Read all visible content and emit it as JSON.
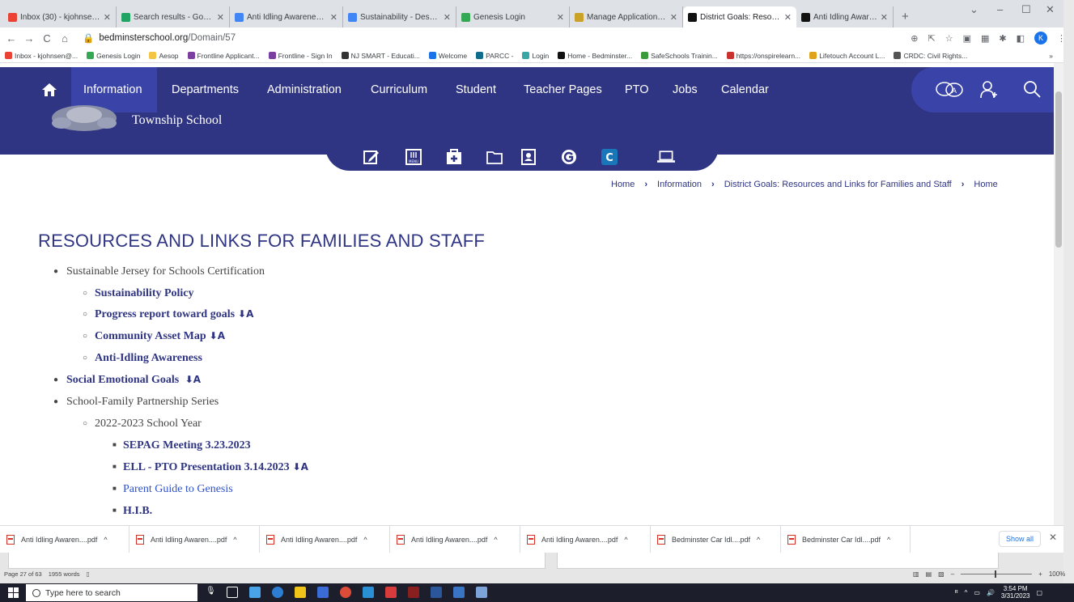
{
  "browser": {
    "tabs": [
      {
        "label": "Inbox (30) - kjohnsen@be",
        "icon": "gmail-icon",
        "color": "#ea4335"
      },
      {
        "label": "Search results - Google D",
        "icon": "google-drive-icon",
        "color": "#1fa463"
      },
      {
        "label": "Anti Idling Awareness - Go",
        "icon": "google-docs-icon",
        "color": "#4285f4"
      },
      {
        "label": "Sustainability - Descriptio",
        "icon": "google-docs-icon",
        "color": "#4285f4"
      },
      {
        "label": "Genesis Login",
        "icon": "genesis-icon",
        "color": "#34a853"
      },
      {
        "label": "Manage Application - Sust",
        "icon": "app-icon",
        "color": "#c9a227"
      },
      {
        "label": "District Goals: Resources a",
        "icon": "bb-icon",
        "color": "#111111",
        "active": true
      },
      {
        "label": "Anti Idling Awareness",
        "icon": "bb-icon",
        "color": "#111111"
      }
    ],
    "new_tab": "+",
    "url_host": "bedminsterschool.org",
    "url_path": "/Domain/57",
    "profile_initial": "K",
    "bookmarks": [
      {
        "label": "Inbox - kjohnsen@...",
        "color": "#ea4335"
      },
      {
        "label": "Genesis Login",
        "color": "#34a853"
      },
      {
        "label": "Aesop",
        "color": "#f4c542"
      },
      {
        "label": "Frontline Applicant...",
        "color": "#7b3fa0"
      },
      {
        "label": "Frontline - Sign In",
        "color": "#7b3fa0"
      },
      {
        "label": "NJ SMART - Educati...",
        "color": "#333333"
      },
      {
        "label": "Welcome",
        "color": "#1a73e8"
      },
      {
        "label": "PARCC -",
        "color": "#0e6c8c"
      },
      {
        "label": "Login",
        "color": "#3aa6a6"
      },
      {
        "label": "Home - Bedminster...",
        "color": "#111111"
      },
      {
        "label": "SafeSchools Trainin...",
        "color": "#3a9b3a"
      },
      {
        "label": "https://onspirelearn...",
        "color": "#c9322f"
      },
      {
        "label": "Lifetouch Account L...",
        "color": "#e0a21b"
      },
      {
        "label": "CRDC: Civil Rights...",
        "color": "#555555"
      }
    ],
    "bookmarks_more": "»"
  },
  "site": {
    "nav": [
      "Information",
      "Departments",
      "Administration",
      "Curriculum",
      "Student",
      "Teacher Pages",
      "PTO",
      "Jobs",
      "Calendar"
    ],
    "school_name_fragment": "Township School",
    "quick_icons": [
      "edit-icon",
      "menu-icon",
      "medical-icon",
      "folder-icon",
      "contacts-icon",
      "genesis-g-icon",
      "c-app-icon",
      "laptop-icon"
    ],
    "menu_icon_text": "MENU",
    "genesis_letter": "C",
    "breadcrumb": [
      "Home",
      "Information",
      "District Goals: Resources and Links for Families and Staff",
      "Home"
    ],
    "page_title": "RESOURCES AND LINKS FOR FAMILIES AND STAFF",
    "list": {
      "item1": "Sustainable Jersey for Schools Certification",
      "item1_sub": [
        "Sustainability Policy",
        "Progress report toward goals",
        "Community Asset Map",
        "Anti-Idling Awareness"
      ],
      "item2": "Social Emotional Goals",
      "item3": "School-Family Partnership Series",
      "item3_sub": "2022-2023 School Year",
      "item3_subsub": [
        "SEPAG Meeting 3.23.2023",
        "ELL - PTO Presentation 3.14.2023",
        "Parent Guide to Genesis",
        "H.I.B."
      ]
    }
  },
  "downloads": {
    "items": [
      "Anti Idling Awaren....pdf",
      "Anti Idling Awaren....pdf",
      "Anti Idling Awaren....pdf",
      "Anti Idling Awaren....pdf",
      "Anti Idling Awaren....pdf",
      "Bedminster Car Idl....pdf",
      "Bedminster Car Idl....pdf"
    ],
    "show_all": "Show all"
  },
  "word": {
    "page": "Page 27 of 63",
    "words": "1955 words",
    "zoom": "100%"
  },
  "taskbar": {
    "search_placeholder": "Type here to search",
    "time": "3:54 PM",
    "date": "3/31/2023"
  }
}
